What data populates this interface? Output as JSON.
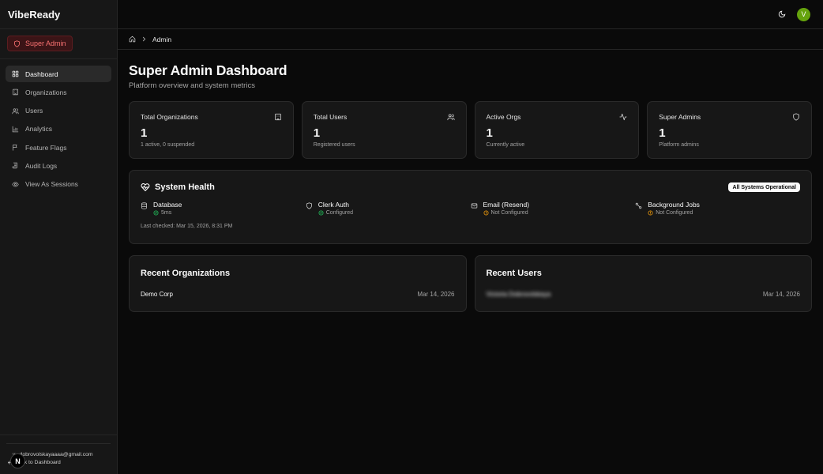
{
  "app": {
    "brand": "VibeReady"
  },
  "role_badge": "Super Admin",
  "nav": [
    {
      "label": "Dashboard",
      "icon": "layout-grid-icon",
      "active": true
    },
    {
      "label": "Organizations",
      "icon": "building-icon"
    },
    {
      "label": "Users",
      "icon": "users-icon"
    },
    {
      "label": "Analytics",
      "icon": "bar-chart-icon"
    },
    {
      "label": "Feature Flags",
      "icon": "flag-icon"
    },
    {
      "label": "Audit Logs",
      "icon": "scroll-icon"
    },
    {
      "label": "View As Sessions",
      "icon": "eye-icon"
    }
  ],
  "footer": {
    "email": "v...dobrovolskayaaaa@gmail.com",
    "back_label": "Back to Dashboard",
    "n_badge": "N"
  },
  "topbar": {
    "avatar_initial": "V"
  },
  "breadcrumb": {
    "current": "Admin"
  },
  "page": {
    "title": "Super Admin Dashboard",
    "subtitle": "Platform overview and system metrics"
  },
  "stats": [
    {
      "title": "Total Organizations",
      "value": "1",
      "sub": "1 active, 0 suspended",
      "icon": "building-icon"
    },
    {
      "title": "Total Users",
      "value": "1",
      "sub": "Registered users",
      "icon": "users-icon"
    },
    {
      "title": "Active Orgs",
      "value": "1",
      "sub": "Currently active",
      "icon": "activity-icon"
    },
    {
      "title": "Super Admins",
      "value": "1",
      "sub": "Platform admins",
      "icon": "shield-icon"
    }
  ],
  "health": {
    "title": "System Health",
    "badge": "All Systems Operational",
    "services": [
      {
        "name": "Database",
        "status": "5ms",
        "state": "ok",
        "icon": "database-icon"
      },
      {
        "name": "Clerk Auth",
        "status": "Configured",
        "state": "ok",
        "icon": "shield-icon"
      },
      {
        "name": "Email (Resend)",
        "status": "Not Configured",
        "state": "warn",
        "icon": "mail-icon"
      },
      {
        "name": "Background Jobs",
        "status": "Not Configured",
        "state": "warn",
        "icon": "workflow-icon"
      }
    ],
    "last_checked": "Last checked: Mar 15, 2026, 8:31 PM"
  },
  "recent_orgs": {
    "title": "Recent Organizations",
    "rows": [
      {
        "name": "Demo Corp",
        "date": "Mar 14, 2026"
      }
    ]
  },
  "recent_users": {
    "title": "Recent Users",
    "rows": [
      {
        "name": "Victoria Dobrovolskaya",
        "date": "Mar 14, 2026"
      }
    ]
  },
  "colors": {
    "ok": "#22c55e",
    "warn": "#f59e0b",
    "danger": "#f87171",
    "avatar": "#65a30d"
  }
}
